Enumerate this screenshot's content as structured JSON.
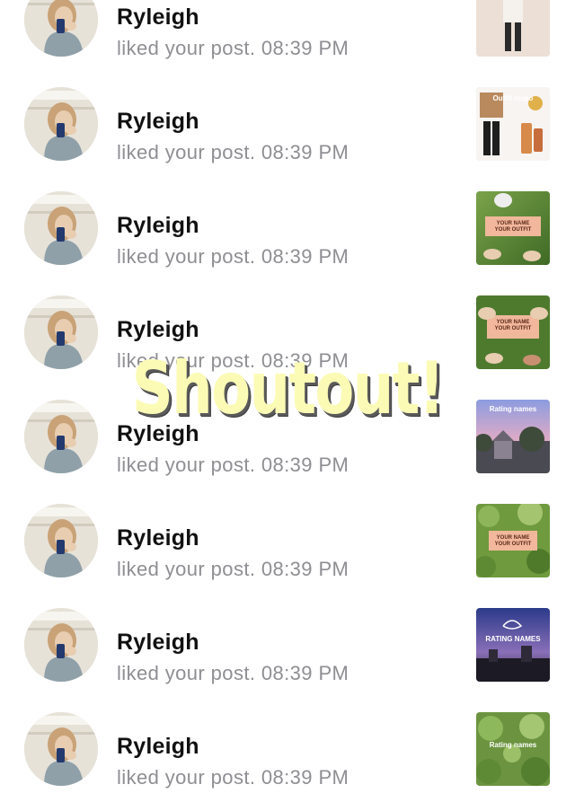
{
  "notifications": [
    {
      "name": "Ryleigh",
      "activity": "liked your post. 08:39 PM",
      "thumb": "outfit-photo-mirror"
    },
    {
      "name": "Ryleigh",
      "activity": "liked your post. 08:39 PM",
      "thumb": "outfit-board",
      "thumb_label": "Outfit inspo"
    },
    {
      "name": "Ryleigh",
      "activity": "liked your post. 08:39 PM",
      "thumb": "grass-sign",
      "thumb_label": "YOUR NAME YOUR OUTFIT"
    },
    {
      "name": "Ryleigh",
      "activity": "liked your post. 08:39 PM",
      "thumb": "grass-sign-hands",
      "thumb_label": "YOUR NAME YOUR OUTFIT"
    },
    {
      "name": "Ryleigh",
      "activity": "liked your post. 08:39 PM",
      "thumb": "sunset-houses",
      "thumb_label": "Rating names"
    },
    {
      "name": "Ryleigh",
      "activity": "liked your post. 08:39 PM",
      "thumb": "greenery-sign",
      "thumb_label": "YOUR NAME YOUR OUTFIT"
    },
    {
      "name": "Ryleigh",
      "activity": "liked your post. 08:39 PM",
      "thumb": "night-sky",
      "thumb_label": "RATING NAMES"
    },
    {
      "name": "Ryleigh",
      "activity": "liked your post. 08:39 PM",
      "thumb": "greenery-rating",
      "thumb_label": "Rating names"
    }
  ],
  "overlay_text": "Shoutout!",
  "colors": {
    "name": "#111111",
    "activity": "#8e8e93",
    "overlay": "#fbfbb6"
  }
}
